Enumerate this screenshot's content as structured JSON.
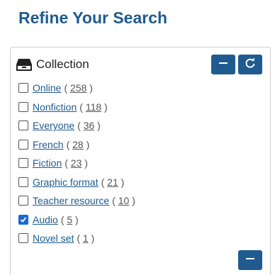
{
  "page": {
    "title": "Refine Your Search"
  },
  "panel": {
    "title": "Collection",
    "icon": "drawer-icon",
    "accent_color": "#1f5b8e",
    "header_buttons": [
      {
        "name": "collapse",
        "icon": "minus-icon"
      },
      {
        "name": "reset",
        "icon": "refresh-icon"
      }
    ],
    "facets": [
      {
        "label": "Online",
        "count": "258",
        "checked": false
      },
      {
        "label": "Nonfiction",
        "count": "118",
        "checked": false
      },
      {
        "label": "Everyone",
        "count": "36",
        "checked": false
      },
      {
        "label": "French",
        "count": "28",
        "checked": false
      },
      {
        "label": "Fiction",
        "count": "23",
        "checked": false
      },
      {
        "label": "Graphic format",
        "count": "21",
        "checked": false
      },
      {
        "label": "Teacher resource",
        "count": "10",
        "checked": false
      },
      {
        "label": "Audio",
        "count": "5",
        "checked": true
      },
      {
        "label": "Novel set",
        "count": "1",
        "checked": false
      }
    ],
    "footer_button": {
      "icon": "minus-icon"
    }
  }
}
